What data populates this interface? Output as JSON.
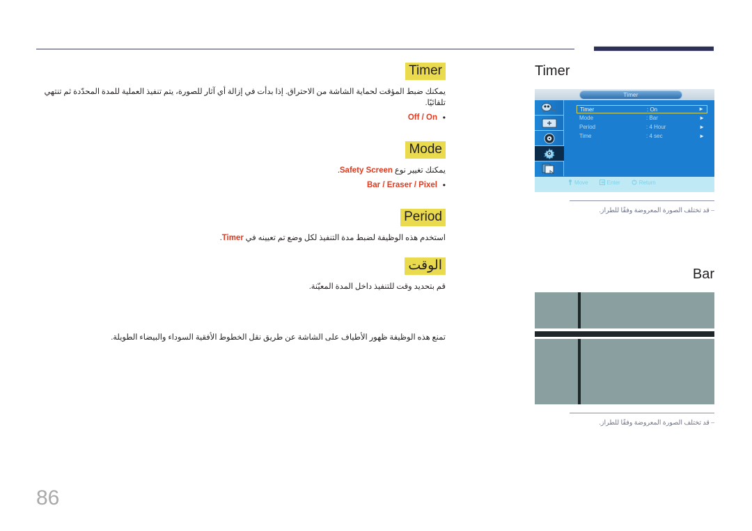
{
  "page": {
    "number": "86"
  },
  "left": {
    "sections": [
      {
        "heading": "Timer",
        "heading_dir": "ltr",
        "body": "يمكنك ضبط المؤقت لحماية الشاشة من الاحتراق. إذا بدأت في إزالة أي آثار للصورة، يتم تنفيذ العملية للمدة المحدّدة ثم تنتهي تلقائيًا.",
        "options": "Off / On"
      },
      {
        "heading": "Mode",
        "heading_dir": "ltr",
        "body_prefix": "يمكنك تغيير نوع ",
        "body_en": "Safety Screen",
        "body_suffix": ".",
        "options": "Bar / Eraser / Pixel"
      },
      {
        "heading": "Period",
        "heading_dir": "ltr",
        "body_prefix": "استخدم هذه الوظيفة لضبط مدة التنفيذ لكل وضع تم تعيينه في ",
        "body_en": "Timer",
        "body_suffix": "."
      },
      {
        "heading": "الوقت",
        "heading_dir": "rtl",
        "body": "قم بتحديد وقت للتنفيذ داخل المدة المعيّنة."
      }
    ],
    "bar_description": "تمنع هذه الوظيفة ظهور الأطياف على الشاشة عن طريق نقل الخطوط الأفقية السوداء والبيضاء الطويلة."
  },
  "right": {
    "osd_figure": {
      "title": "Timer",
      "menu_title": "Timer",
      "sidebar_icons": [
        "input-plug-icon",
        "picture-display-icon",
        "sound-speaker-icon",
        "setup-gear-icon",
        "multi-control-icon"
      ],
      "selected_sidebar_index": 3,
      "rows": [
        {
          "label": "Timer",
          "value": ": On",
          "arrow": "►",
          "highlighted": true
        },
        {
          "label": "Mode",
          "value": ": Bar",
          "arrow": "►",
          "highlighted": false
        },
        {
          "label": "Period",
          "value": ": 4 Hour",
          "arrow": "►",
          "highlighted": false
        },
        {
          "label": "Time",
          "value": ": 4 sec",
          "arrow": "►",
          "highlighted": false
        }
      ],
      "footer": [
        {
          "icon": "move-joystick-icon",
          "label": "Move"
        },
        {
          "icon": "enter-key-icon",
          "label": "Enter"
        },
        {
          "icon": "return-arrow-icon",
          "label": "Return"
        }
      ],
      "caption": "‒ قد تختلف الصورة المعروضة وفقًا للطراز."
    },
    "bar_figure": {
      "title": "Bar",
      "caption": "‒ قد تختلف الصورة المعروضة وفقًا للطراز."
    }
  },
  "colors": {
    "heading_highlight": "#e9da4e",
    "option_red": "#e03a1e",
    "rule_navy": "#2e3157",
    "osd_blue": "#1b7ed0",
    "bar_gray": "#8a9fa0",
    "bar_dark": "#1e2628",
    "page_number": "#a9a9a9"
  }
}
